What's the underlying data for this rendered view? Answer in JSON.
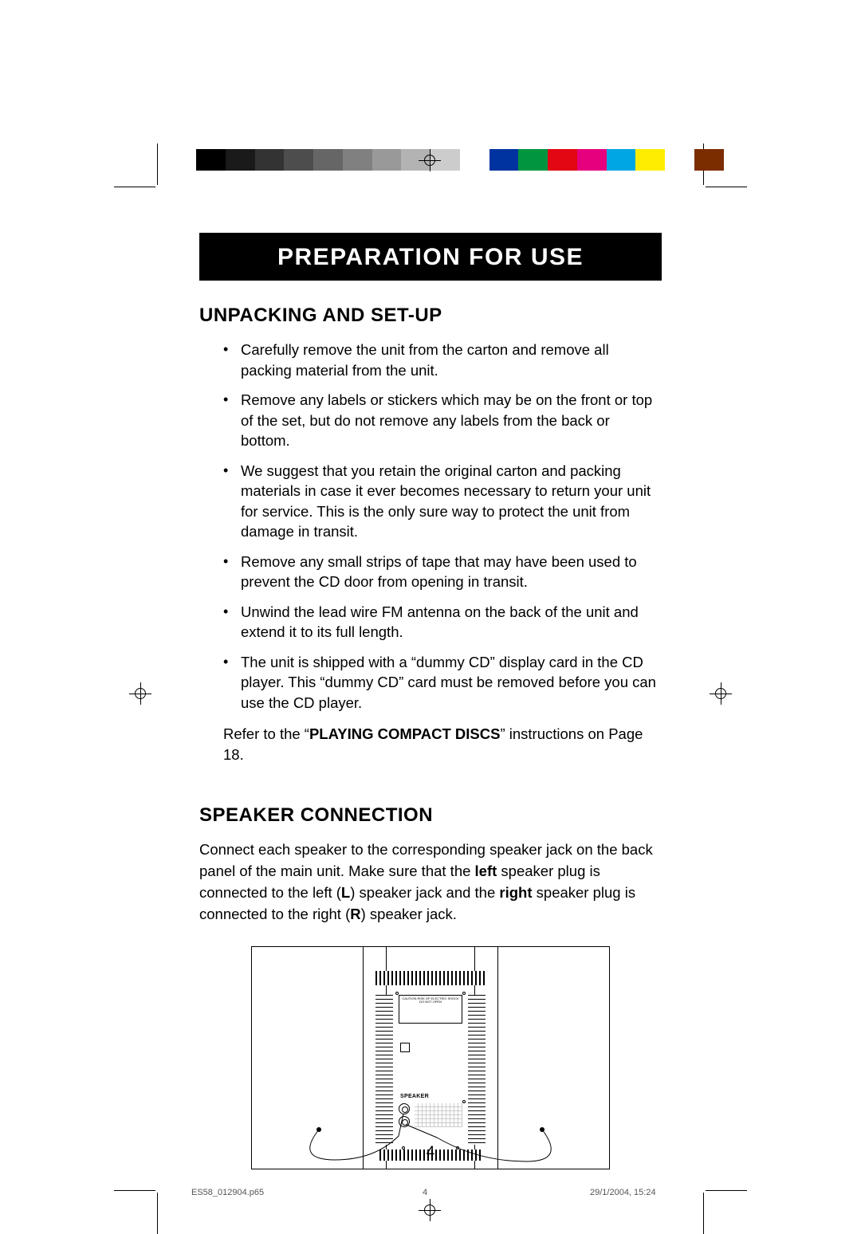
{
  "print": {
    "color_strip": [
      "#000000",
      "#1a1a1a",
      "#333333",
      "#4d4d4d",
      "#666666",
      "#808080",
      "#999999",
      "#b3b3b3",
      "#cccccc",
      "#ffffff",
      "#0033a0",
      "#009640",
      "#e30613",
      "#e6007e",
      "#00a6e2",
      "#ffed00",
      "#ffffff",
      "#7b2d00"
    ],
    "filename": "ES58_012904.p65",
    "sheet_page": "4",
    "print_timestamp": "29/1/2004, 15:24"
  },
  "title_bar": "PREPARATION FOR USE",
  "section1": {
    "heading": "UNPACKING AND SET-UP",
    "bullets": [
      "Carefully remove the unit from the carton and remove all packing material from the unit.",
      "Remove any labels or stickers which may be on the front or top of the set, but do not remove any labels from the back or bottom.",
      "We suggest that you retain the original carton and packing materials in case it ever becomes necessary to return your unit for service. This is the only sure way to protect the unit from damage in transit.",
      "Remove any small strips of tape that may have been used to prevent the CD door from opening in transit.",
      "Unwind the lead wire FM antenna on the back of the unit and extend it to its full length.",
      "The unit is shipped with a “dummy CD” display card in the CD player. This “dummy CD” card must be removed before you can use the CD player."
    ],
    "refer_pre": "Refer to the “",
    "refer_bold": "PLAYING COMPACT DISCS",
    "refer_post": "” instructions on Page 18."
  },
  "section2": {
    "heading": "SPEAKER CONNECTION",
    "para_parts": {
      "p1": "Connect each speaker to the corresponding speaker jack on the back panel of the main unit. Make sure that the ",
      "b1": "left",
      "p2": " speaker plug is connected to the left (",
      "b2": "L",
      "p3": ") speaker jack and the ",
      "b3": "right",
      "p4": " speaker plug is connected to the right (",
      "b4": "R",
      "p5": ") speaker jack."
    }
  },
  "diagram": {
    "speaker_label": "SPEAKER",
    "caution_text": "CAUTION  RISK OF ELECTRIC SHOCK  DO NOT OPEN"
  },
  "page_number": "4"
}
